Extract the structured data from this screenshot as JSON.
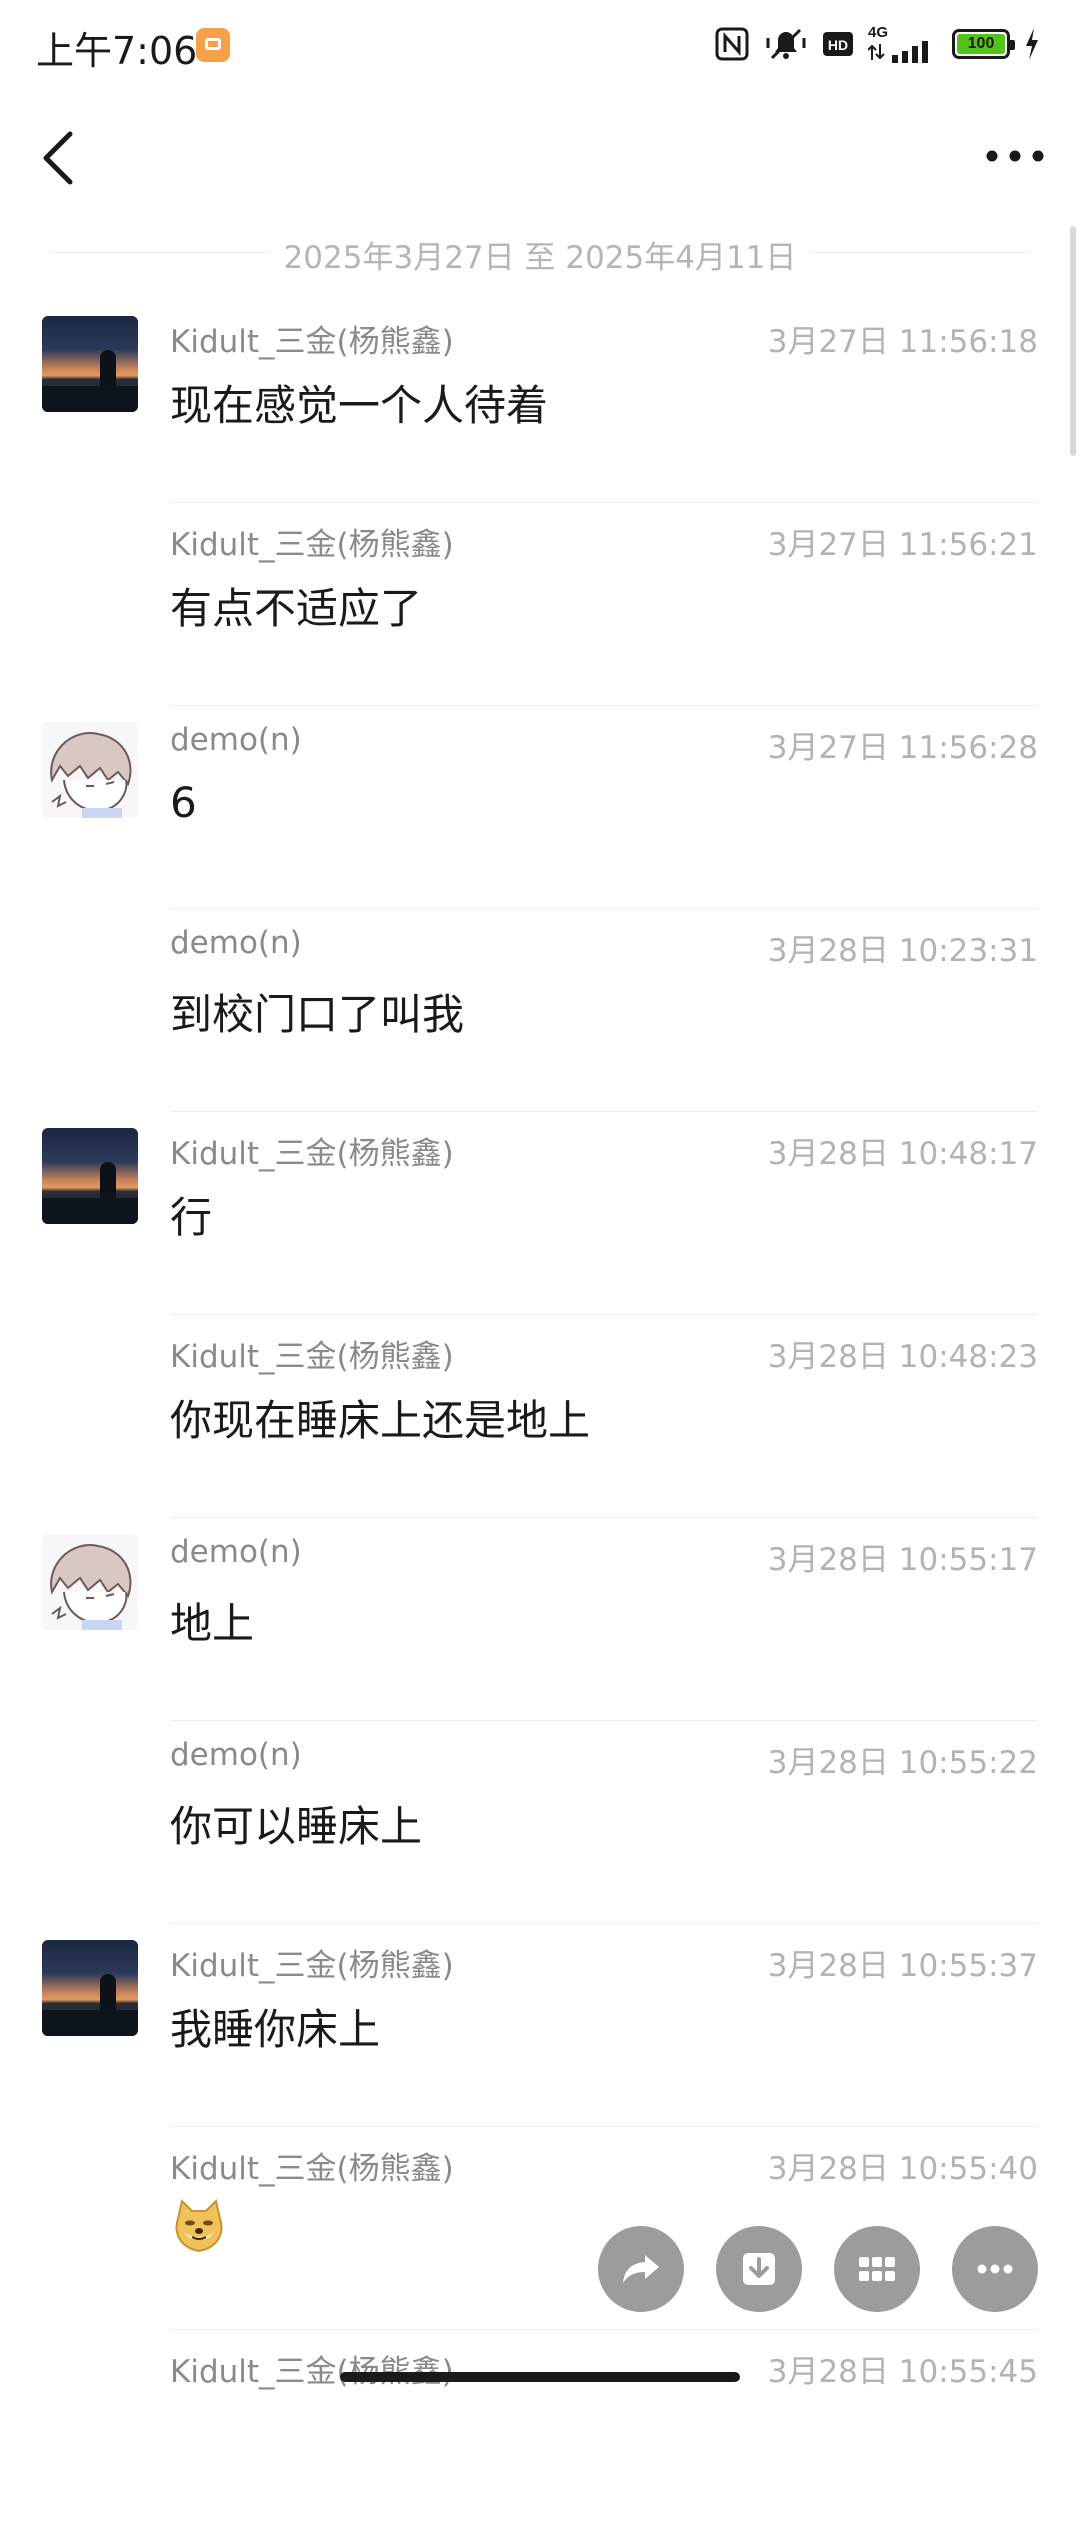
{
  "status_bar": {
    "time": "上午7:06",
    "network": "4G",
    "battery": "100"
  },
  "header": {
    "back_icon": "chevron-left-icon",
    "more_icon": "ellipsis-horizontal-icon"
  },
  "date_range": "2025年3月27日 至 2025年4月11日",
  "messages": [
    {
      "sender": "Kidult_三金(杨熊鑫)",
      "time": "3月27日 11:56:18",
      "text": "现在感觉一个人待着",
      "avatar": "sunset"
    },
    {
      "sender": "Kidult_三金(杨熊鑫)",
      "time": "3月27日 11:56:21",
      "text": "有点不适应了",
      "avatar": "none"
    },
    {
      "sender": "demo(n)",
      "time": "3月27日 11:56:28",
      "text": "6",
      "avatar": "cartoon"
    },
    {
      "sender": "demo(n)",
      "time": "3月28日 10:23:31",
      "text": "到校门口了叫我",
      "avatar": "none"
    },
    {
      "sender": "Kidult_三金(杨熊鑫)",
      "time": "3月28日 10:48:17",
      "text": "行",
      "avatar": "sunset"
    },
    {
      "sender": "Kidult_三金(杨熊鑫)",
      "time": "3月28日 10:48:23",
      "text": "你现在睡床上还是地上",
      "avatar": "none"
    },
    {
      "sender": "demo(n)",
      "time": "3月28日 10:55:17",
      "text": "地上",
      "avatar": "cartoon"
    },
    {
      "sender": "demo(n)",
      "time": "3月28日 10:55:22",
      "text": "你可以睡床上",
      "avatar": "none"
    },
    {
      "sender": "Kidult_三金(杨熊鑫)",
      "time": "3月28日 10:55:37",
      "text": "我睡你床上",
      "avatar": "sunset"
    },
    {
      "sender": "Kidult_三金(杨熊鑫)",
      "time": "3月28日 10:55:40",
      "text": "",
      "avatar": "none",
      "emoji": "doge-emoji"
    },
    {
      "sender": "Kidult_三金(杨熊鑫)",
      "time": "3月28日 10:55:45",
      "text": "",
      "avatar": "none"
    }
  ],
  "actions": [
    {
      "name": "share",
      "icon": "share-arrow-icon"
    },
    {
      "name": "save",
      "icon": "download-icon"
    },
    {
      "name": "grid",
      "icon": "grid-icon"
    },
    {
      "name": "more",
      "icon": "more-dots-icon"
    }
  ],
  "colors": {
    "notification_badge": "#f6a04a",
    "battery_fill": "#52c41a",
    "fab_background": "#9c9c9c",
    "sender_text": "#8a8a8a",
    "time_text": "#b3b3b3"
  }
}
